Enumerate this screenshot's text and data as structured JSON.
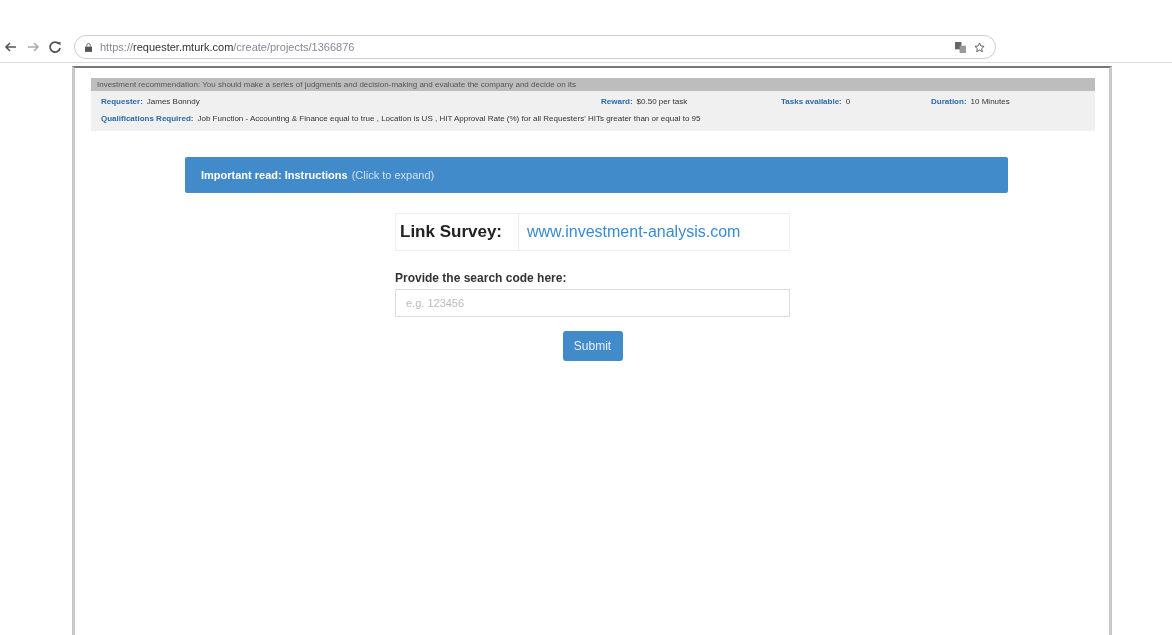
{
  "browser": {
    "url": "https://**requester.mturk.com**/create/projects/1366876"
  },
  "hit": {
    "description": "Investment recommendation: You should make a series of judgments and decision-making and evaluate the company and decide on its",
    "fields": [
      {
        "label": "Requester:",
        "value": "James Bonndy"
      },
      {
        "label": "Reward:",
        "value": "$0.50 per task"
      },
      {
        "label": "Tasks available:",
        "value": "0"
      },
      {
        "label": "Duration:",
        "value": "10 Minutes"
      }
    ],
    "qualifications": {
      "label": "Qualifications Required:",
      "value": "Job Function - Accounting & Finance equal to true , Location is US , HIT Approval Rate (%) for all Requesters' HITs greater than or equal to 95"
    }
  },
  "instructions": {
    "title": "Important read: Instructions",
    "hint": "(Click to expand)",
    "expanded": false
  },
  "survey": {
    "label": "Link Survey:",
    "link": "www.investment-analysis.com"
  },
  "code": {
    "label": "Provide the search code here:",
    "placeholder": "e.g. 123456"
  },
  "submit": "Submit"
}
